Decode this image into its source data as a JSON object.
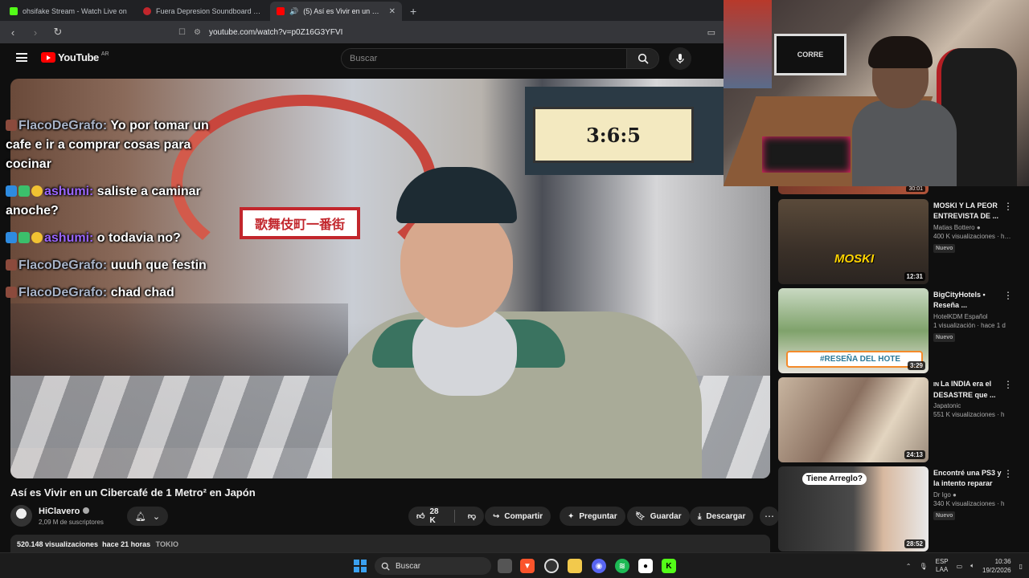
{
  "browser": {
    "tabs": [
      {
        "title": "ohsifake Stream - Watch Live on",
        "color": "#53fc18"
      },
      {
        "title": "Fuera Depresion Soundboard - Boto",
        "color": "#c2262c"
      },
      {
        "title": "(5) Así es Vivir en un Cibercafé",
        "color": "#ff0000"
      }
    ],
    "url": "youtube.com/watch?v=p0Z16G3YFVI"
  },
  "youtube": {
    "logo_text": "YouTube",
    "country_code": "AR",
    "search_placeholder": "Buscar"
  },
  "video": {
    "sign_text": "歌舞伎町一番街",
    "board_text": "3:6:5",
    "chat": [
      {
        "user": "FlacoDeGrafo:",
        "text": " Yo por tomar un cafe e ir a comprar cosas para cocinar",
        "color": "#a9b4c8"
      },
      {
        "user": "ashumi:",
        "text": " saliste a caminar anoche?",
        "color": "#9a66ff"
      },
      {
        "user": "ashumi:",
        "text": " o todavia no?",
        "color": "#9a66ff"
      },
      {
        "user": "FlacoDeGrafo:",
        "text": " uuuh que festin",
        "color": "#a9b4c8"
      },
      {
        "user": "FlacoDeGrafo:",
        "text": " chad chad",
        "color": "#a9b4c8"
      }
    ],
    "title": "Así es Vivir en un Cibercafé de 1 Metro² en Japón",
    "channel": "HiClavero",
    "subscribers": "2,09 M de suscriptores",
    "likes": "28 K",
    "actions": {
      "share": "Compartir",
      "ask": "Preguntar",
      "save": "Guardar",
      "download": "Descargar"
    },
    "views": "520.148 visualizaciones",
    "age": "hace 21 horas",
    "tag": "TOKIO"
  },
  "sidebar": {
    "top_duration": "30:01",
    "items": [
      {
        "title": "MOSKI Y LA PEOR ENTREVISTA DE ...",
        "channel": "Matias Bottero",
        "meta": "400 K visualizaciones · hace",
        "badge": "Nuevo",
        "duration": "12:31",
        "overlay": "MOSKI"
      },
      {
        "title": "BigCityHotels • Reseña ...",
        "channel": "HotelKDM Español",
        "meta": "1 visualización · hace 1 d",
        "badge": "Nuevo",
        "duration": "3:29",
        "overlay": "#RESEÑA DEL HOTE"
      },
      {
        "title": "La INDIA era el DESASTRE que ...",
        "channel": "Japatonic",
        "meta": "551 K visualizaciones · h",
        "badge": "",
        "duration": "24:13",
        "overlay": ""
      },
      {
        "title": "Encontré una PS3 y la intento reparar",
        "channel": "Dr Igo",
        "meta": "340 K visualizaciones · h",
        "badge": "Nuevo",
        "duration": "28:52",
        "overlay": "Tiene Arreglo?"
      }
    ]
  },
  "webcam": {
    "frame_text": "CORRE"
  },
  "taskbar": {
    "search_placeholder": "Buscar",
    "lang_top": "ESP",
    "lang_bottom": "LAA",
    "time": "10:36",
    "date": "19/2/2026"
  }
}
